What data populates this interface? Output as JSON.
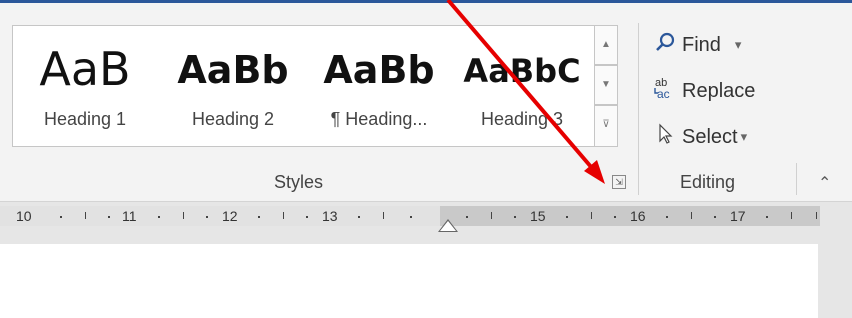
{
  "styles_gallery": {
    "items": [
      {
        "sample": "AaB",
        "label": "Heading 1"
      },
      {
        "sample": "AaBb",
        "label": "Heading 2"
      },
      {
        "sample": "AaBb",
        "label": "¶ Heading..."
      },
      {
        "sample": "AaBbC",
        "label": "Heading 3"
      }
    ],
    "group_label": "Styles",
    "launcher_glyph": "⇲"
  },
  "editing": {
    "find": {
      "label": "Find",
      "icon": "search-icon",
      "caret": "▾"
    },
    "replace": {
      "label": "Replace",
      "icon": "replace-icon"
    },
    "select": {
      "label": "Select",
      "icon": "cursor-icon",
      "caret": "▾"
    },
    "group_label": "Editing"
  },
  "collapse_glyph": "⌃",
  "ruler": {
    "numbers": [
      "10",
      "11",
      "12",
      "13",
      "15",
      "16",
      "17"
    ]
  },
  "colors": {
    "accent": "#2b579a",
    "annotation_arrow": "#e60000"
  }
}
